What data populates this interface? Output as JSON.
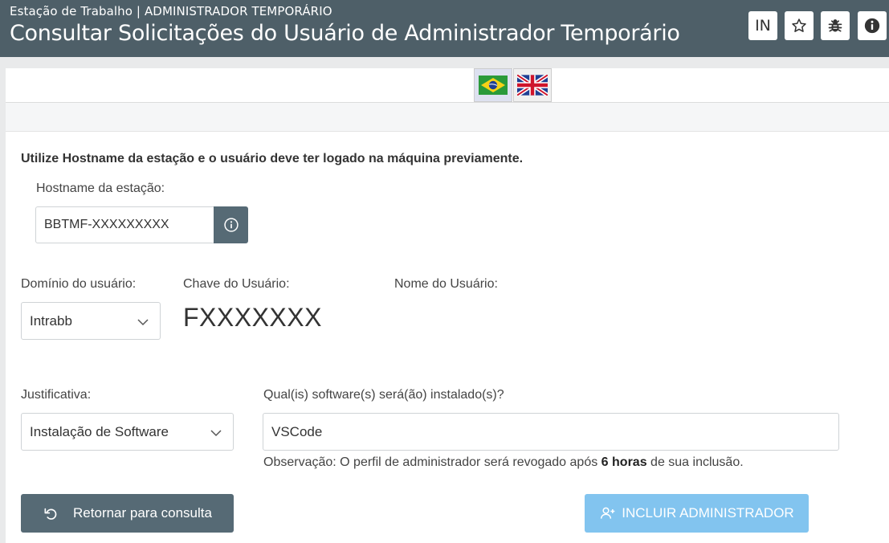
{
  "header": {
    "subtitle": "Estação de Trabalho | ADMINISTRADOR TEMPORÁRIO",
    "title": "Consultar Solicitações do Usuário de Administrador Temporário",
    "in_button_label": "IN",
    "background_color": "#4e5f68"
  },
  "languages": [
    {
      "code": "pt-BR",
      "icon": "brazil-flag-icon",
      "selected": true
    },
    {
      "code": "en",
      "icon": "uk-flag-icon",
      "selected": false
    }
  ],
  "form": {
    "instruction": "Utilize Hostname da estação e o usuário deve ter logado na máquina previamente.",
    "hostname_label": "Hostname da estação:",
    "hostname_value": "BBTMF-XXXXXXXXX",
    "domain_label": "Domínio do usuário:",
    "domain_value": "Intrabb",
    "user_key_label": "Chave do Usuário:",
    "user_key_value": "FXXXXXXX",
    "user_name_label": "Nome do Usuário:",
    "user_name_value": "",
    "justification_label": "Justificativa:",
    "justification_value": "Instalação de Software",
    "software_label": "Qual(is) software(s) será(ão) instalado(s)?",
    "software_value": "VSCode",
    "note_prefix": "Observação: O perfil de administrador será revogado após ",
    "note_bold": "6 horas",
    "note_suffix": " de sua inclusão."
  },
  "buttons": {
    "back_label": "Retornar para consulta",
    "add_label": "INCLUIR ADMINISTRADOR",
    "back_color": "#566a75",
    "add_color": "#82c4ef"
  }
}
